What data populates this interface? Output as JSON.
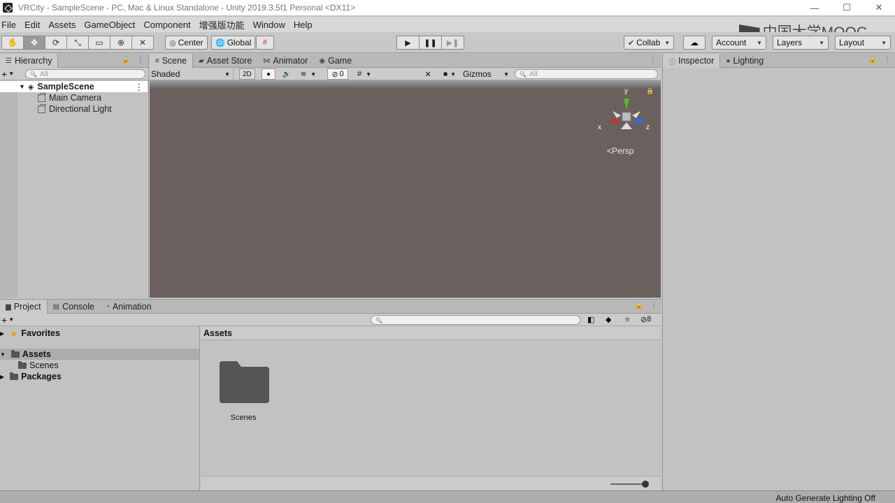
{
  "window": {
    "title": "VRCity - SampleScene - PC, Mac & Linux Standalone - Unity 2019.3.5f1 Personal <DX11>",
    "minimize": "—",
    "maximize": "☐",
    "close": "✕"
  },
  "menu": [
    "File",
    "Edit",
    "Assets",
    "GameObject",
    "Component",
    "增强版功能",
    "Window",
    "Help"
  ],
  "watermark": "中国大学MOOC",
  "toolbar": {
    "tools": [
      "✋",
      "✥",
      "⟳",
      "⤡",
      "▭",
      "⊕",
      "✕"
    ],
    "center_label": "Center",
    "global_label": "Global",
    "play": "▶",
    "pause": "❚❚",
    "step": "▶❚",
    "collab_label": "Collab",
    "cloud_icon": "☁",
    "account_label": "Account",
    "layers_label": "Layers",
    "layout_label": "Layout"
  },
  "hierarchy": {
    "tab_label": "Hierarchy",
    "search_placeholder": "All",
    "add": "+",
    "scene": "SampleScene",
    "items": [
      "Main Camera",
      "Directional Light"
    ]
  },
  "scene_view": {
    "tabs": [
      "Scene",
      "Asset Store",
      "Animator",
      "Game"
    ],
    "shading_mode": "Shaded",
    "mode_2d": "2D",
    "hidden_count": "0",
    "gizmos_label": "Gizmos",
    "search_placeholder": "All",
    "gizmo_axes": {
      "x": "x",
      "y": "y",
      "z": "z"
    },
    "projection_label": "Persp",
    "colors": {
      "background": "#6a605e",
      "x_axis": "#c0392b",
      "y_axis": "#5cb82c",
      "z_axis": "#2d6fd8"
    }
  },
  "inspector": {
    "tabs": [
      "Inspector",
      "Lighting"
    ]
  },
  "project": {
    "tabs": [
      "Project",
      "Console",
      "Animation"
    ],
    "add": "+",
    "tree": {
      "favorites": "Favorites",
      "assets": "Assets",
      "scenes": "Scenes",
      "packages": "Packages"
    },
    "hidden_packages_count": "8",
    "breadcrumb": "Assets",
    "folders": [
      {
        "name": "Scenes"
      }
    ],
    "zoom_fraction": 1.0
  },
  "status": {
    "right_text": "Auto Generate Lighting Off"
  }
}
